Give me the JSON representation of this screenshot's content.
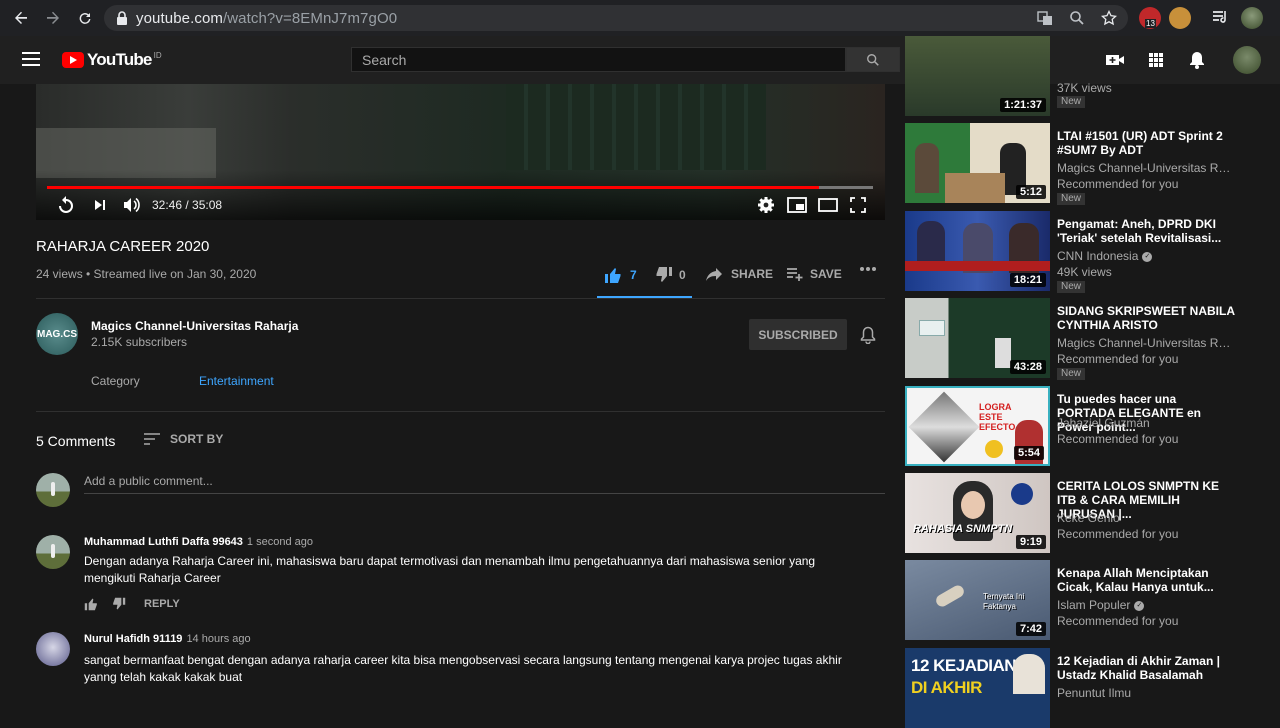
{
  "browser": {
    "url_host": "youtube.com",
    "url_path": "/watch?v=8EMnJ7m7gO0",
    "ext_badge": "13"
  },
  "header": {
    "logo_text": "YouTube",
    "logo_region": "ID",
    "search_placeholder": "Search"
  },
  "player": {
    "time": "32:46 / 35:08",
    "progress": 0.935
  },
  "video": {
    "title": "RAHARJA CAREER 2020",
    "meta": "24 views • Streamed live on Jan 30, 2020",
    "likes": "7",
    "dislikes": "0",
    "share_label": "SHARE",
    "save_label": "SAVE"
  },
  "channel": {
    "avatar_text": "MAG.CS",
    "name": "Magics Channel-Universitas Raharja",
    "subscribers": "2.15K subscribers",
    "subscribed_label": "SUBSCRIBED",
    "category_label": "Category",
    "category_value": "Entertainment"
  },
  "comments": {
    "count": "5 Comments",
    "sort_label": "SORT BY",
    "add_placeholder": "Add a public comment...",
    "reply_label": "REPLY",
    "items": [
      {
        "author": "Muhammad Luthfi Daffa 99643",
        "ago": "1 second ago",
        "text": "Dengan adanya Raharja Career ini, mahasiswa baru dapat termotivasi dan menambah ilmu pengetahuannya dari mahasiswa senior yang mengikuti Raharja Career"
      },
      {
        "author": "Nurul Hafidh 91119",
        "ago": "14 hours ago",
        "text": "sangat bermanfaat bengat dengan adanya raharja career kita bisa mengobservasi secara langsung tentang mengenai karya projec tugas akhir yanng telah kakak kakak buat"
      }
    ]
  },
  "sidebar": {
    "items": [
      {
        "title": "",
        "channel": "",
        "sub": "37K views",
        "badge": "New",
        "duration": "1:21:37"
      },
      {
        "title": "LTAI #1501 (UR) ADT Sprint 2 #SUM7 By ADT",
        "channel": "Magics Channel-Universitas Raharja",
        "sub": "Recommended for you",
        "badge": "New",
        "duration": "5:12"
      },
      {
        "title": "Pengamat: Aneh, DPRD DKI 'Teriak' setelah Revitalisasi...",
        "channel": "CNN Indonesia",
        "sub": "49K views",
        "badge": "New",
        "duration": "18:21"
      },
      {
        "title": "SIDANG SKRIPSWEET NABILA CYNTHIA ARISTO",
        "channel": "Magics Channel-Universitas Raharja",
        "sub": "Recommended for you",
        "badge": "New",
        "duration": "43:28"
      },
      {
        "title": "Tu puedes hacer una PORTADA ELEGANTE en Power point...",
        "channel": "Jahaziel Guzmán",
        "sub": "Recommended for you",
        "badge": "",
        "duration": "5:54"
      },
      {
        "title": "CERITA LOLOS SNMPTN KE ITB & CARA MEMILIH JURUSAN |...",
        "channel": "Keke Genio",
        "sub": "Recommended for you",
        "badge": "",
        "duration": "9:19"
      },
      {
        "title": "Kenapa Allah Menciptakan Cicak, Kalau Hanya untuk...",
        "channel": "Islam Populer",
        "sub": "Recommended for you",
        "badge": "",
        "duration": "7:42"
      },
      {
        "title": "12 Kejadian di Akhir Zaman | Ustadz Khalid Basalamah",
        "channel": "Penuntut Ilmu",
        "sub": "",
        "badge": "",
        "duration": ""
      }
    ],
    "thumb_text": {
      "logra": "LOGRA ESTE EFECTO",
      "snmptn": "RAHASIA SNMPTN",
      "cicak": "Ternyata Ini Faktanya",
      "kejadian1": "12 KEJADIAN",
      "kejadian2": "DI AKHIR"
    }
  }
}
